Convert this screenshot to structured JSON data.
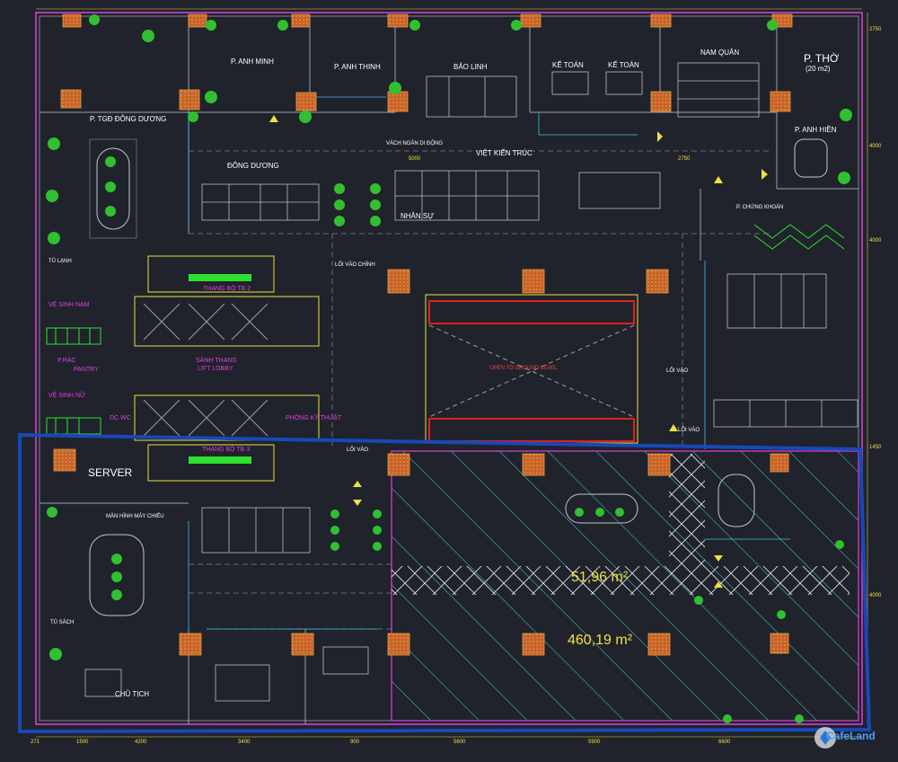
{
  "rooms": {
    "p_anh_minh": "P. ANH MINH",
    "p_anh_thinh": "P. ANH THINH",
    "bao_linh": "BẢO LINH",
    "ke_toan_1": "KẾ TOÁN",
    "ke_toan_2": "KẾ TOÁN",
    "nam_quan": "NAM QUÂN",
    "p_tho": "P. THỜ",
    "p_tho_area": "(20 m2)",
    "p_tgd_dong_duong": "P. TGĐ ĐÔNG DƯƠNG",
    "p_anh_hien": "P. ANH HIỀN",
    "vach_ngan_di_dong": "VÁCH NGĂN DI ĐỘNG",
    "viet_kien_truc": "VIỆT KIẾN TRÚC",
    "dong_duong": "ĐÔNG DƯƠNG",
    "nhan_su": "NHÂN SỰ",
    "p_chung_khoan": "P. CHỨNG KHOÁN",
    "tu_lanh": "TỦ LẠNH",
    "loi_vao_chinh": "LỐI VÀO CHÍNH",
    "thang_bo_1": "THANG BỘ TB 2",
    "ve_sinh_nam": "VỆ SINH NAM",
    "sanh_thang": "SẢNH THANG",
    "lift_lobby": "LIFT LOBBY",
    "rac": "P.RÁC",
    "pantry": "PANTRY",
    "ve_sinh_nu": "VỆ SINH NỮ",
    "dc_wc": "DC WC",
    "phong_ky_thuat": "PHÒNG KỸ THUẬT",
    "thang_bo_2": "THANG BỘ TB 3",
    "void": "OPEN TO GROUND LEVEL",
    "loi_vao": "LỐI VÀO",
    "server": "SERVER",
    "man_hinh_may_chieu": "MÀN HÌNH MÁY CHIẾU",
    "tu_sach": "TỦ SÁCH",
    "chu_tich": "CHỦ TỊCH"
  },
  "areas": {
    "area_1": "51,96 m²",
    "area_2": "460,19 m²"
  },
  "dims": {
    "bottom": [
      "271",
      "1500",
      "4200",
      "3400",
      "900",
      "5600",
      "5900",
      "6600"
    ],
    "inner": [
      "5000",
      "2750"
    ],
    "right": [
      "2750",
      "4000",
      "4000",
      "1450",
      "4000"
    ]
  },
  "colors": {
    "background": "#20232b",
    "hatch": "#4fd0d0",
    "walls": "#e040e0",
    "highlight": "#1848b8",
    "plants": "#30c030",
    "area_text": "#f0e040"
  },
  "watermark": "CafeLand"
}
